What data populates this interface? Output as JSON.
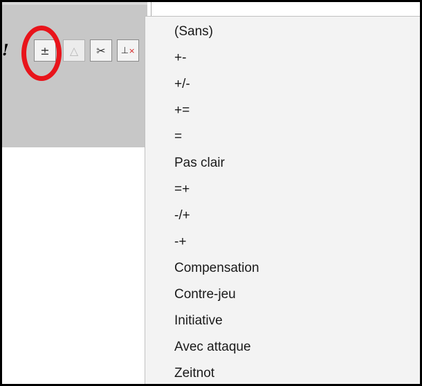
{
  "toolbar": {
    "excl_label": "!",
    "buttons": [
      {
        "icon": "plus-minus-icon",
        "glyph": "±"
      },
      {
        "icon": "disabled-triangle-icon",
        "glyph": "△"
      },
      {
        "icon": "scissors-icon",
        "glyph": "✂"
      },
      {
        "icon": "delete-variation-icon",
        "glyph": "⊥",
        "mark": "×"
      }
    ]
  },
  "annotation_color": "#e8141b",
  "menu": {
    "items": [
      "(Sans)",
      "+-",
      "+/-",
      "+=",
      "=",
      "Pas clair",
      "=+",
      "-/+",
      "-+",
      "Compensation",
      "Contre-jeu",
      "Initiative",
      "Avec attaque",
      "Zeitnot"
    ]
  }
}
